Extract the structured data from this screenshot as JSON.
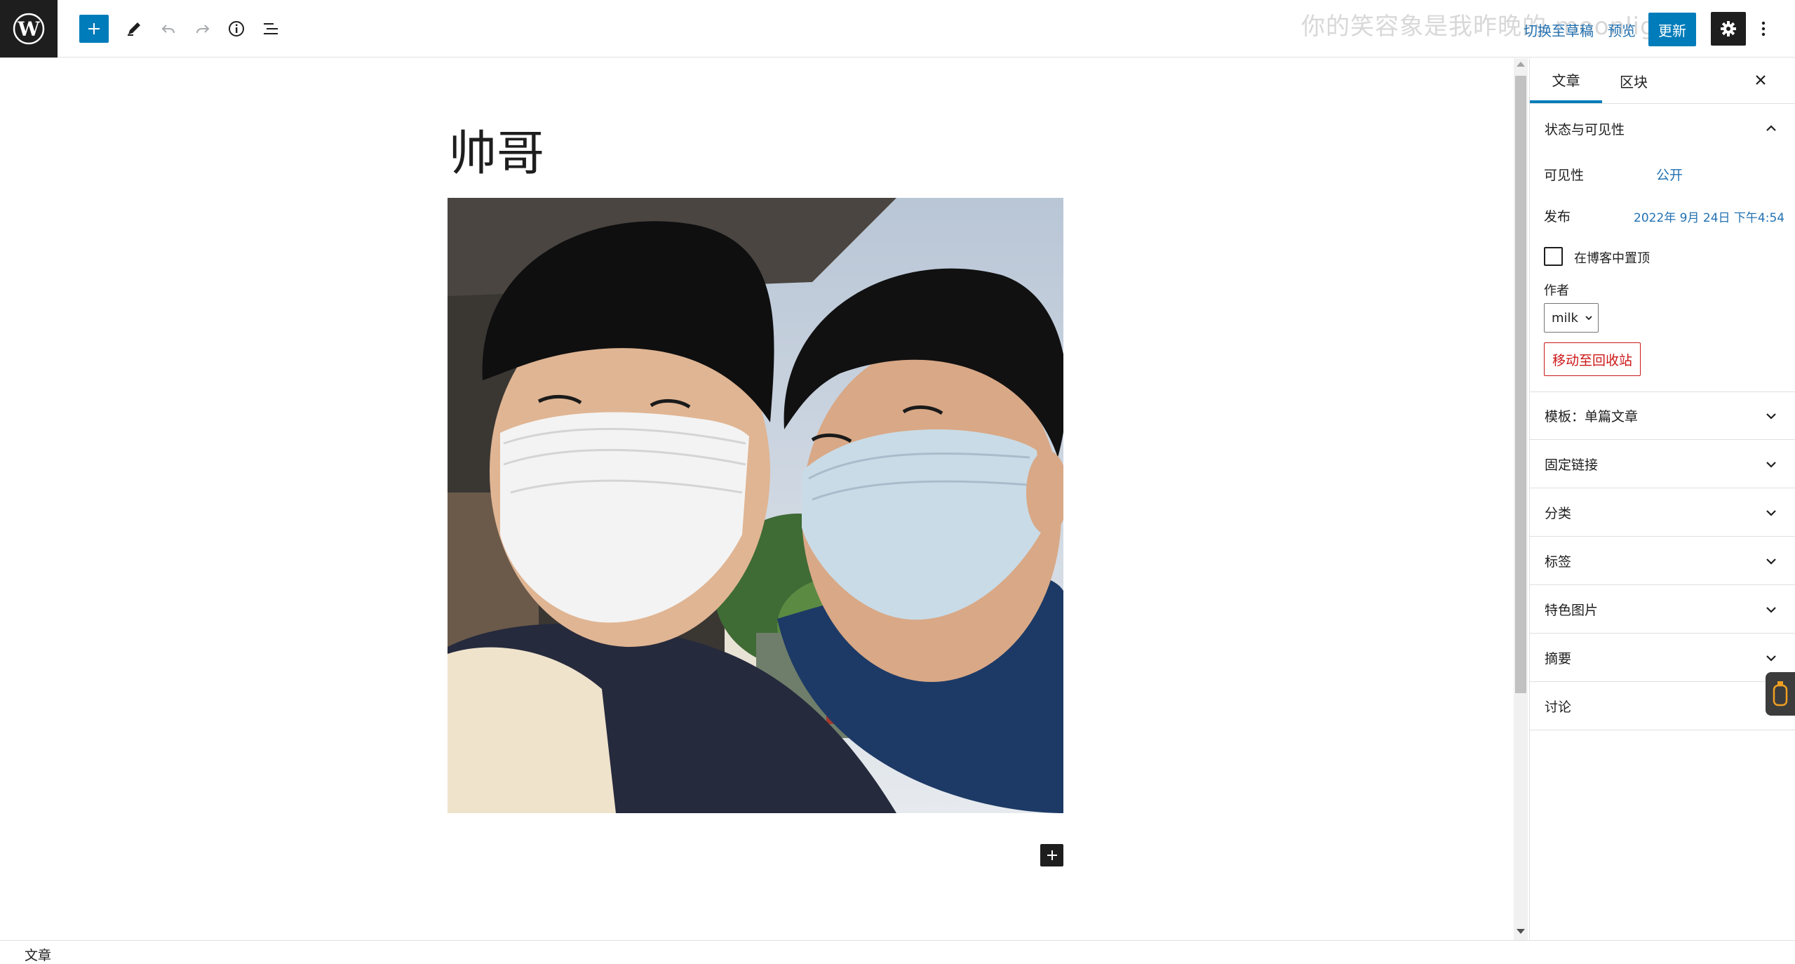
{
  "toolbar": {
    "logo_icon": "wordpress-icon",
    "inserter_icon": "plus-icon",
    "edit_tool_icon": "pencil-icon",
    "undo_icon": "undo-icon",
    "redo_icon": "redo-icon",
    "details_icon": "info-icon",
    "list_view_icon": "list-view-icon",
    "overlay_lyric": "你的笑容象是我昨晚的 moonlight",
    "switch_to_draft": "切换至草稿",
    "preview": "预览",
    "update": "更新",
    "settings_icon": "gear-icon",
    "options_icon": "vertical-ellipsis-icon",
    "accent_color": "#007cba"
  },
  "editor": {
    "title": "帅哥",
    "image_alt": "两位戴口罩的男生自拍",
    "appender_icon": "plus-icon"
  },
  "sidebar": {
    "tabs": [
      {
        "label": "文章",
        "active": true
      },
      {
        "label": "区块",
        "active": false
      }
    ],
    "close_icon": "close-icon",
    "status_panel": {
      "title": "状态与可见性",
      "visibility_label": "可见性",
      "visibility_value": "公开",
      "publish_label": "发布",
      "publish_value": "2022年 9月 24日 下午4:54",
      "sticky_label": "在博客中置顶",
      "sticky_checked": false,
      "author_label": "作者",
      "author_value": "milk",
      "trash_label": "移动至回收站"
    },
    "panels": [
      {
        "label": "模板：单篇文章"
      },
      {
        "label": "固定链接"
      },
      {
        "label": "分类"
      },
      {
        "label": "标签"
      },
      {
        "label": "特色图片"
      },
      {
        "label": "摘要"
      },
      {
        "label": "讨论"
      }
    ]
  },
  "footer": {
    "breadcrumb": "文章"
  }
}
